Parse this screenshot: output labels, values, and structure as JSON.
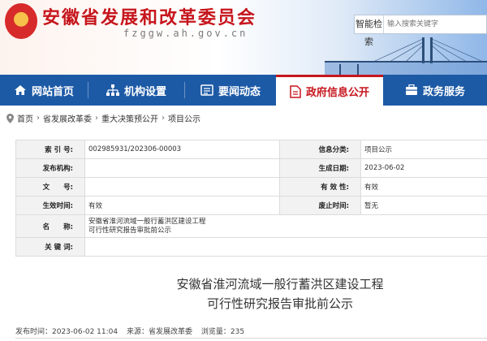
{
  "header": {
    "title": "安徽省发展和改革委员会",
    "domain": "fzggw.ah.gov.cn",
    "search_label": "智能检索",
    "search_placeholder": "输入搜索关键字"
  },
  "nav": {
    "items": [
      {
        "label": "网站首页",
        "icon": "home-icon"
      },
      {
        "label": "机构设置",
        "icon": "org-structure-icon"
      },
      {
        "label": "要闻动态",
        "icon": "news-icon"
      },
      {
        "label": "政府信息公开",
        "icon": "document-icon",
        "active": true
      },
      {
        "label": "政务服务",
        "icon": "service-icon"
      }
    ],
    "active_color": "#c6161d",
    "bar_color": "#1d5aa6"
  },
  "breadcrumb": [
    "首页",
    "省发展改革委",
    "重大决策预公开",
    "项目公示"
  ],
  "info": {
    "index_label": "索 引 号:",
    "index_value": "002985931/202306-00003",
    "category_label": "信息分类:",
    "category_value": "项目公示",
    "issuer_label": "发布机构:",
    "issuer_value": "",
    "date_label": "生成日期:",
    "date_value": "2023-06-02",
    "doc_label": "文　　号:",
    "doc_value": "",
    "validity_label": "有 效 性:",
    "validity_value": "有效",
    "effective_label": "生效时间:",
    "effective_value": "有效",
    "expire_label": "废止时间:",
    "expire_value": "暂无",
    "name_label": "名　　称:",
    "name_line1": "安徽省淮河流域一般行蓄洪区建设工程",
    "name_line2": "可行性研究报告审批前公示",
    "keywords_label": "关 键 词:",
    "keywords_value": ""
  },
  "article": {
    "title_line1": "安徽省淮河流域一般行蓄洪区建设工程",
    "title_line2": "可行性研究报告审批前公示",
    "publish_time": "发布时间：2023-06-02 11:04",
    "source": "来源：省发展改革委",
    "views": "浏览量：235"
  }
}
